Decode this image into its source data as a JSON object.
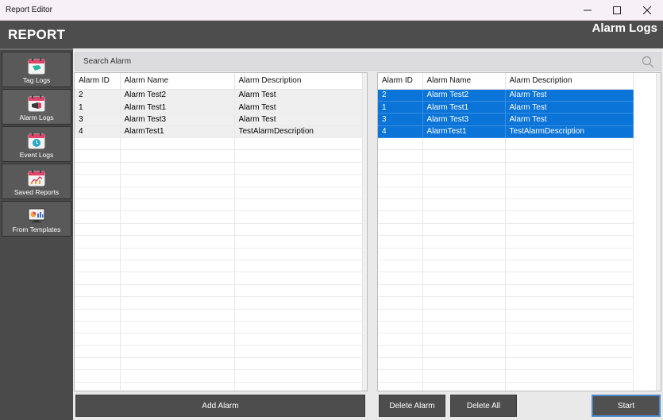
{
  "window": {
    "title": "Report Editor",
    "controls": {
      "minimize": "—",
      "maximize": "☐",
      "close": "✕"
    }
  },
  "header": {
    "app_title": "REPORT",
    "section_title": "Alarm Logs"
  },
  "sidebar": {
    "items": [
      {
        "label": "Tag Logs",
        "icon": "tag-calendar-icon"
      },
      {
        "label": "Alarm Logs",
        "icon": "alarm-calendar-icon",
        "active": true
      },
      {
        "label": "Event Logs",
        "icon": "clock-calendar-icon"
      },
      {
        "label": "Saved Reports",
        "icon": "chart-calendar-icon"
      },
      {
        "label": "From Templates",
        "icon": "template-monitor-icon"
      }
    ]
  },
  "search": {
    "placeholder": "Search Alarm",
    "icon": "search-icon"
  },
  "left_table": {
    "columns": [
      "Alarm ID",
      "Alarm Name",
      "Alarm Description"
    ],
    "rows": [
      [
        "2",
        "Alarm Test2",
        "Alarm Test"
      ],
      [
        "1",
        "Alarm Test1",
        "Alarm Test"
      ],
      [
        "3",
        "Alarm Test3",
        "Alarm Test"
      ],
      [
        "4",
        "AlarmTest1",
        "TestAlarmDescription"
      ]
    ]
  },
  "right_table": {
    "columns": [
      "Alarm ID",
      "Alarm Name",
      "Alarm Description"
    ],
    "rows": [
      [
        "2",
        "Alarm Test2",
        "Alarm Test"
      ],
      [
        "1",
        "Alarm Test1",
        "Alarm Test"
      ],
      [
        "3",
        "Alarm Test3",
        "Alarm Test"
      ],
      [
        "4",
        "AlarmTest1",
        "TestAlarmDescription"
      ]
    ]
  },
  "buttons": {
    "add": "Add Alarm",
    "delete": "Delete Alarm",
    "delete_all": "Delete All",
    "start": "Start"
  },
  "colors": {
    "header": "#4d4d4d",
    "sidebar": "#4a4a4a",
    "selection": "#0a74d8"
  }
}
